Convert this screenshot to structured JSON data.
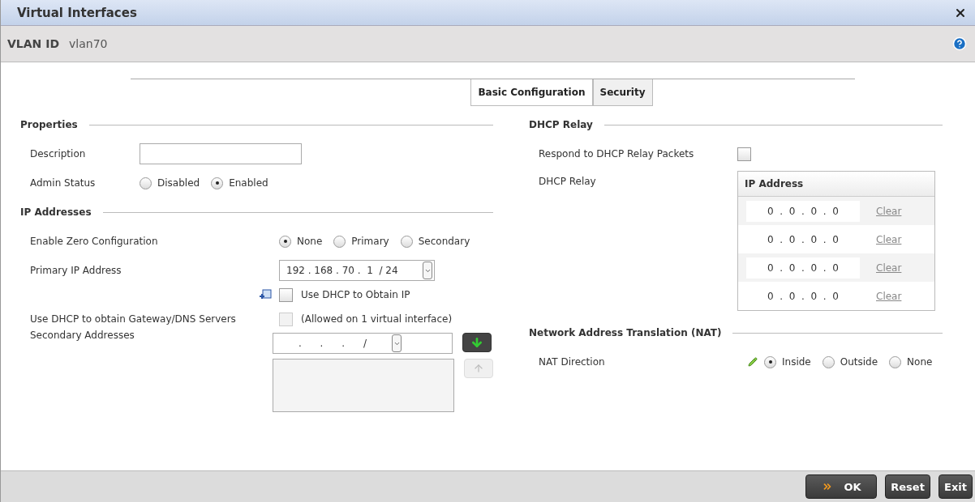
{
  "window": {
    "title": "Virtual Interfaces"
  },
  "vlan": {
    "label": "VLAN ID",
    "value": "vlan70"
  },
  "tabs": [
    {
      "label": "Basic Configuration",
      "selected": true
    },
    {
      "label": "Security",
      "selected": false
    }
  ],
  "properties": {
    "title": "Properties",
    "description": {
      "label": "Description"
    },
    "admin_status": {
      "label": "Admin Status",
      "options": [
        {
          "label": "Disabled",
          "selected": false
        },
        {
          "label": "Enabled",
          "selected": true
        }
      ]
    }
  },
  "ip_addresses": {
    "title": "IP Addresses",
    "zero_config": {
      "label": "Enable Zero Configuration",
      "options": [
        {
          "label": "None",
          "selected": true
        },
        {
          "label": "Primary",
          "selected": false
        },
        {
          "label": "Secondary",
          "selected": false
        }
      ]
    },
    "primary_ip": {
      "label": "Primary IP Address",
      "value": "192 . 168 . 70 .  1  / 24"
    },
    "use_dhcp": {
      "label": "Use DHCP to Obtain IP",
      "checked": false
    },
    "dhcp_gateway": {
      "label": "Use DHCP to obtain Gateway/DNS Servers",
      "note": "(Allowed on 1 virtual interface)",
      "checked": false,
      "disabled": true
    },
    "secondary": {
      "label": "Secondary Addresses",
      "value": "      .      .      .      /"
    }
  },
  "dhcp_relay": {
    "title": "DHCP Relay",
    "respond": {
      "label": "Respond to DHCP Relay Packets",
      "checked": false
    },
    "relay_label": "DHCP Relay",
    "column": "IP Address",
    "rows": [
      {
        "value": "0  .  0  .  0  .  0",
        "action": "Clear"
      },
      {
        "value": "0  .  0  .  0  .  0",
        "action": "Clear"
      },
      {
        "value": "0  .  0  .  0  .  0",
        "action": "Clear"
      },
      {
        "value": "0  .  0  .  0  .  0",
        "action": "Clear"
      }
    ]
  },
  "nat": {
    "title": "Network Address Translation (NAT)",
    "direction": {
      "label": "NAT Direction",
      "options": [
        {
          "label": "Inside",
          "selected": true
        },
        {
          "label": "Outside",
          "selected": false
        },
        {
          "label": "None",
          "selected": false
        }
      ]
    }
  },
  "buttons": [
    "OK",
    "Reset",
    "Exit"
  ]
}
